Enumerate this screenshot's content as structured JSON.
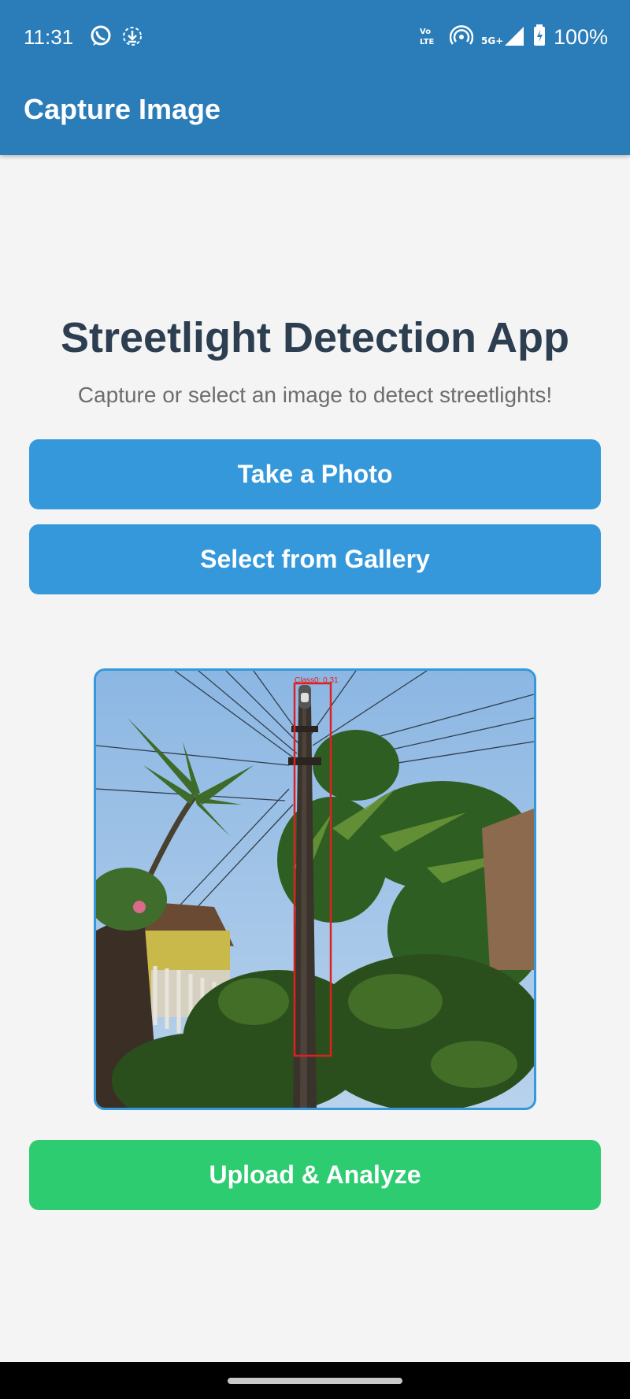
{
  "status_bar": {
    "time": "11:31",
    "battery": "100%",
    "icons": [
      "whatsapp-icon",
      "download-icon",
      "volte-icon",
      "hotspot-icon",
      "5g-signal-icon",
      "battery-icon"
    ]
  },
  "app_bar": {
    "title": "Capture Image",
    "color": "#2a7db8"
  },
  "main": {
    "title": "Streetlight Detection App",
    "subtitle": "Capture or select an image to detect streetlights!"
  },
  "buttons": {
    "take_photo": "Take a Photo",
    "select_gallery": "Select from Gallery",
    "upload_analyze": "Upload & Analyze"
  },
  "preview": {
    "detection_label": "Class0: 0.31",
    "box_color": "#e02020"
  },
  "colors": {
    "primary_button": "#3498db",
    "success_button": "#2ecc71",
    "title_text": "#2c3e50"
  }
}
